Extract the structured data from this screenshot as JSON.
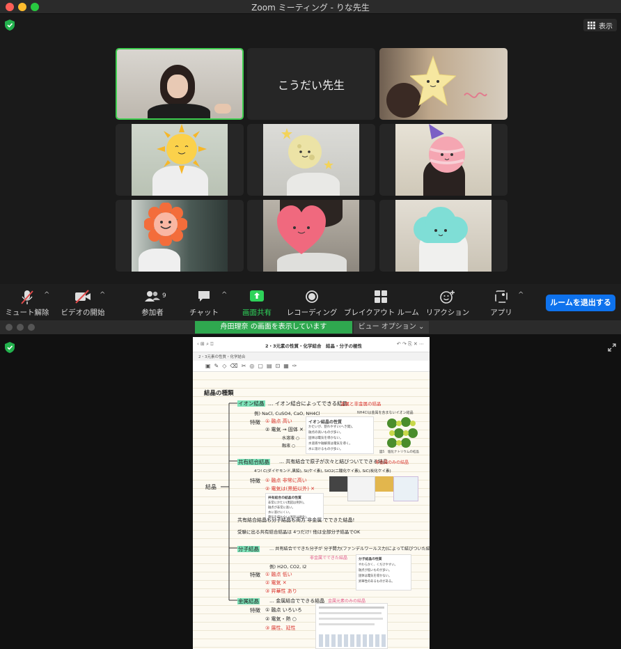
{
  "window": {
    "title": "Zoom ミーティング - りな先生"
  },
  "view_button": {
    "label": "表示"
  },
  "participants": [
    {
      "name": "",
      "avatar": "photo-person",
      "active": true
    },
    {
      "name": "こうだい先生",
      "avatar": "name-only",
      "active": false
    },
    {
      "name": "",
      "avatar": "star-sticker",
      "active": false
    },
    {
      "name": "",
      "avatar": "sun-sticker",
      "active": false
    },
    {
      "name": "",
      "avatar": "moon-sticker",
      "active": false
    },
    {
      "name": "",
      "avatar": "planet-sticker",
      "active": false
    },
    {
      "name": "",
      "avatar": "flower-sticker",
      "active": false
    },
    {
      "name": "",
      "avatar": "heart-sticker",
      "active": false
    },
    {
      "name": "",
      "avatar": "cloud-sticker",
      "active": false
    }
  ],
  "toolbar": {
    "mute": "ミュート解除",
    "video": "ビデオの開始",
    "participants": "参加者",
    "participants_count": "9",
    "chat": "チャット",
    "share": "画面共有",
    "record": "レコーディング",
    "breakout": "ブレイクアウト ルーム",
    "reactions": "リアクション",
    "apps": "アプリ",
    "leave": "ルームを退出する"
  },
  "share": {
    "banner": "舟田理奈 の画面を表示しています",
    "view_options": "ビュー オプション"
  },
  "document": {
    "title": "2・3元素の性質・化学結合　結晶・分子の極性",
    "tab": "2・3元素の性質・化学結合",
    "heading": "結晶の種類",
    "root": "結晶",
    "ionic_title": "イオン結晶",
    "ionic_def": "… イオン結合によってできる結晶",
    "ionic_note": "金属と非金属の結晶",
    "ionic_ex": "例) NaCl, CuSO4, CaO, NH4Cl",
    "ionic_ex_note": "NH4Clは金属を含まないイオン結晶",
    "feature": "特徴",
    "ionic_f1": "① 融点 高い",
    "ionic_f2": "② 電気 → 固体 ✕",
    "ionic_f2b": "水溶液 ○",
    "ionic_f2c": "融液 ○",
    "ionic_props_title": "イオン結晶の性質",
    "ionic_props": [
      "かたいが、割れやすい(へき開)。",
      "融点の高いものが多い。",
      "固体は電気を導かない。",
      "水溶液や融解液は電気を導く。",
      "水に溶けるものが多い。"
    ],
    "ionic_caption": "図5　塩化ナトリウムの結晶",
    "covalent_title": "共有結合結晶",
    "covalent_def": "… 共有結合で原子が次々と結びついてできる結晶",
    "covalent_note": "非金属のみの結晶",
    "covalent_ex": "4つ! C(ダイヤモンド,黒鉛), Si(ケイ素), SiO2(二酸化ケイ素), SiC(炭化ケイ素)",
    "covalent_f1": "① 融点 非常に高い",
    "covalent_f2": "② 電気は(黒鉛以外) ✕",
    "covalent_props_title": "共有結合の結晶の性質",
    "covalent_props": [
      "非常にかたい(黒鉛は例外)。",
      "融点が非常に高い。",
      "水に溶けにくい。",
      "電気を導かない(黒鉛は例外)。"
    ],
    "note1": "共有結合結晶も分子結晶も両方 非金属 でできた結晶!",
    "note2": "受験に出る共有結合結晶は 4つだけ! 他は全部分子結晶でOK",
    "molecular_title": "分子結晶",
    "molecular_def": "… 共有結合でできた分子が 分子間力(ファンデルワールス力)によって結びついた結晶",
    "molecular_note": "非金属でできた結晶",
    "molecular_ex": "例) H2O, CO2, I2",
    "molecular_f1": "① 融点 低い",
    "molecular_f2": "② 電気 ✕",
    "molecular_f3": "③ 昇華性 あり",
    "molecular_props_title": "分子結晶の性質",
    "molecular_props": [
      "やわらかく、くだけやすい。",
      "融点が低いものが多い。",
      "固体は電気を導かない。",
      "昇華性のあるものがある。"
    ],
    "metal_title": "金属結晶",
    "metal_def": "… 金属結合でできる結晶",
    "metal_note": "金属元素のみの結晶",
    "metal_f1": "① 融点 いろいろ",
    "metal_f2": "② 電気・熱 ○",
    "metal_f3": "③ 展性、延性"
  },
  "colors": {
    "accent_green": "#2fa84f",
    "leave_blue": "#0e72ed",
    "active_border": "#3ecf4f",
    "highlight_mint": "#7de3b9",
    "note_red": "#d9322b"
  }
}
